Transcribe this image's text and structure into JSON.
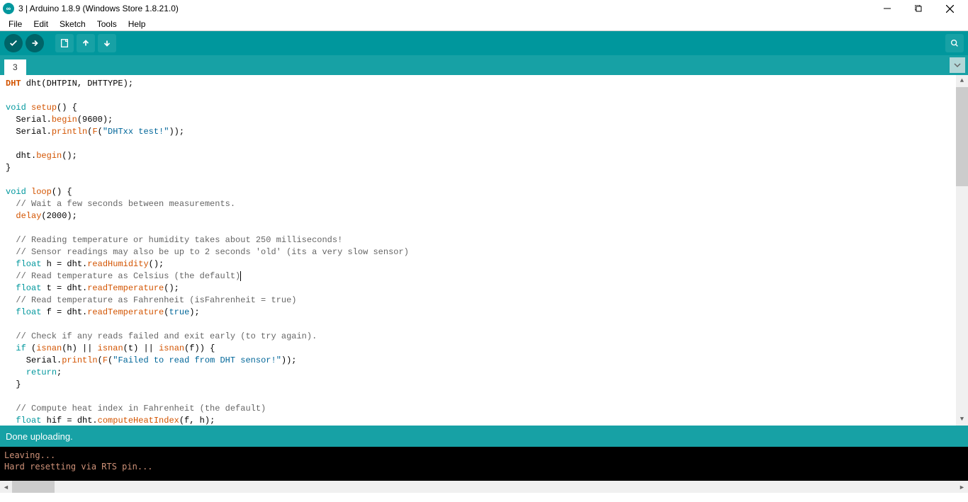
{
  "window": {
    "title": "3 | Arduino 1.8.9 (Windows Store 1.8.21.0)",
    "logo_text": "∞"
  },
  "menu": [
    "File",
    "Edit",
    "Sketch",
    "Tools",
    "Help"
  ],
  "toolbar": {
    "verify": "verify-icon",
    "upload": "upload-icon",
    "new": "new-icon",
    "open": "open-icon",
    "save": "save-icon",
    "serial": "serial-monitor-icon"
  },
  "tab": {
    "label": "3"
  },
  "code": {
    "l1_ty": "DHT",
    "l1_rest": " dht(DHTPIN, DHTTYPE);",
    "l3_kw": "void",
    "l3_rest1": " ",
    "l3_fn": "setup",
    "l3_rest2": "() {",
    "l4_a": "  Serial.",
    "l4_fn": "begin",
    "l4_b": "(9600);",
    "l5_a": "  Serial.",
    "l5_fn": "println",
    "l5_b": "(",
    "l5_c": "F",
    "l5_d": "(",
    "l5_str": "\"DHTxx test!\"",
    "l5_e": "));",
    "l7_a": "  dht.",
    "l7_fn": "begin",
    "l7_b": "();",
    "l8": "}",
    "l10_kw": "void",
    "l10_rest1": " ",
    "l10_fn": "loop",
    "l10_rest2": "() {",
    "l11": "  // Wait a few seconds between measurements.",
    "l12_a": "  ",
    "l12_fn": "delay",
    "l12_b": "(2000);",
    "l14": "  // Reading temperature or humidity takes about 250 milliseconds!",
    "l15": "  // Sensor readings may also be up to 2 seconds 'old' (its a very slow sensor)",
    "l16_kw": "float",
    "l16_a": " h = dht.",
    "l16_fn": "readHumidity",
    "l16_b": "();",
    "l17": "  // Read temperature as Celsius (the default)",
    "l18_kw": "float",
    "l18_a": " t = dht.",
    "l18_fn": "readTemperature",
    "l18_b": "();",
    "l19": "  // Read temperature as Fahrenheit (isFahrenheit = true)",
    "l20_kw": "float",
    "l20_a": " f = dht.",
    "l20_fn": "readTemperature",
    "l20_b": "(",
    "l20_lit": "true",
    "l20_c": ");",
    "l22": "  // Check if any reads failed and exit early (to try again).",
    "l23_kw": "if",
    "l23_a": " (",
    "l23_fn1": "isnan",
    "l23_b": "(h) || ",
    "l23_fn2": "isnan",
    "l23_c": "(t) || ",
    "l23_fn3": "isnan",
    "l23_d": "(f)) {",
    "l24_a": "    Serial.",
    "l24_fn": "println",
    "l24_b": "(",
    "l24_c": "F",
    "l24_d": "(",
    "l24_str": "\"Failed to read from DHT sensor!\"",
    "l24_e": "));",
    "l25_a": "    ",
    "l25_kw": "return",
    "l25_b": ";",
    "l26": "  }",
    "l28": "  // Compute heat index in Fahrenheit (the default)",
    "l29_kw": "float",
    "l29_a": " hif = dht.",
    "l29_fn": "computeHeatIndex",
    "l29_b": "(f, h);"
  },
  "status": "Done uploading.",
  "console": {
    "line1": "Leaving...",
    "line2": "Hard resetting via RTS pin..."
  }
}
